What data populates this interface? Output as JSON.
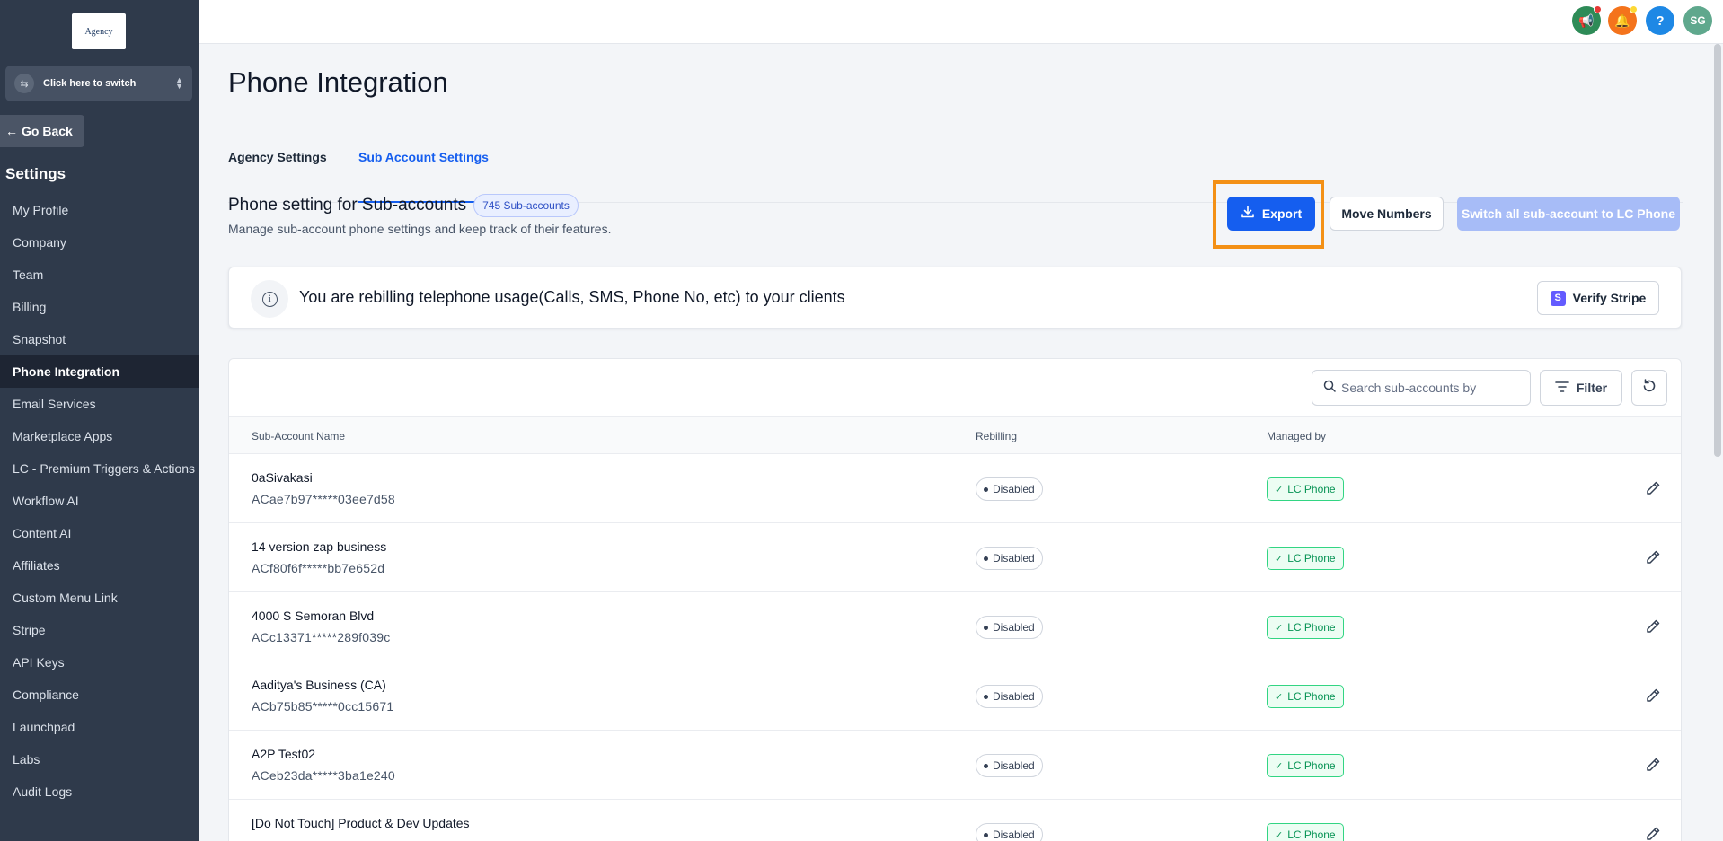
{
  "sidebar": {
    "logo_text": "Agency",
    "switcher_label": "Click here to switch",
    "go_back": "Go Back",
    "settings_title": "Settings",
    "items": [
      {
        "label": "My Profile"
      },
      {
        "label": "Company"
      },
      {
        "label": "Team"
      },
      {
        "label": "Billing"
      },
      {
        "label": "Snapshot"
      },
      {
        "label": "Phone Integration",
        "active": true
      },
      {
        "label": "Email Services"
      },
      {
        "label": "Marketplace Apps"
      },
      {
        "label": "LC - Premium Triggers & Actions"
      },
      {
        "label": "Workflow AI"
      },
      {
        "label": "Content AI"
      },
      {
        "label": "Affiliates"
      },
      {
        "label": "Custom Menu Link"
      },
      {
        "label": "Stripe"
      },
      {
        "label": "API Keys"
      },
      {
        "label": "Compliance"
      },
      {
        "label": "Launchpad"
      },
      {
        "label": "Labs"
      },
      {
        "label": "Audit Logs"
      }
    ]
  },
  "topbar": {
    "icons": [
      {
        "name": "announcement-icon",
        "color": "#2e8b57",
        "glyph": "📢",
        "dot": "#e53935"
      },
      {
        "name": "notification-bell-icon",
        "color": "#f4731c",
        "glyph": "🔔",
        "dot": "#fdd835"
      },
      {
        "name": "help-icon",
        "color": "#1e88e5",
        "glyph": "?"
      },
      {
        "name": "avatar",
        "color": "#5fa88d",
        "glyph": "SG"
      }
    ]
  },
  "page": {
    "title": "Phone Integration",
    "tabs": [
      {
        "label": "Agency Settings",
        "active": false
      },
      {
        "label": "Sub Account Settings",
        "active": true
      }
    ],
    "section_title": "Phone setting for Sub-accounts",
    "count_badge": "745 Sub-accounts",
    "section_sub": "Manage sub-account phone settings and keep track of their features.",
    "buttons": {
      "export": "Export",
      "move_numbers": "Move Numbers",
      "switch_all": "Switch all sub-account to LC Phone"
    },
    "rebill_text": "You are rebilling telephone usage(Calls, SMS, Phone No, etc) to your clients",
    "verify_stripe": "Verify Stripe"
  },
  "table": {
    "search_placeholder": "Search sub-accounts by",
    "filter_label": "Filter",
    "columns": [
      "Sub-Account Name",
      "Rebilling",
      "Managed by"
    ],
    "rows": [
      {
        "name": "0aSivakasi",
        "sid": "ACae7b97*****03ee7d58",
        "rebilling": "Disabled",
        "managed_by": "LC Phone"
      },
      {
        "name": "14 version zap business",
        "sid": "ACf80f6f*****bb7e652d",
        "rebilling": "Disabled",
        "managed_by": "LC Phone"
      },
      {
        "name": "4000 S Semoran Blvd",
        "sid": "ACc13371*****289f039c",
        "rebilling": "Disabled",
        "managed_by": "LC Phone"
      },
      {
        "name": "Aaditya's Business (CA)",
        "sid": "ACb75b85*****0cc15671",
        "rebilling": "Disabled",
        "managed_by": "LC Phone"
      },
      {
        "name": "A2P Test02",
        "sid": "ACeb23da*****3ba1e240",
        "rebilling": "Disabled",
        "managed_by": "LC Phone"
      },
      {
        "name": "[Do Not Touch] Product & Dev Updates",
        "sid": "",
        "rebilling": "Disabled",
        "managed_by": "LC Phone"
      }
    ]
  }
}
